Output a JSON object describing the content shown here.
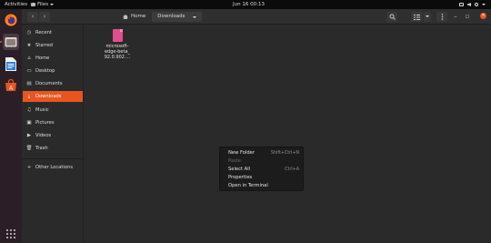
{
  "topbar": {
    "activities": "Activities",
    "app_menu": "Files",
    "clock": "Jun 16  00:13"
  },
  "dock": {
    "apps": [
      "firefox-icon",
      "files-icon",
      "libreoffice-writer-icon",
      "software-center-icon"
    ]
  },
  "window": {
    "breadcrumbs": [
      {
        "label": "Home"
      },
      {
        "label": "Downloads"
      }
    ]
  },
  "sidebar": {
    "items": [
      {
        "label": "Recent",
        "icon": "clock-icon"
      },
      {
        "label": "Starred",
        "icon": "star-icon"
      },
      {
        "label": "Home",
        "icon": "home-icon"
      },
      {
        "label": "Desktop",
        "icon": "desktop-icon"
      },
      {
        "label": "Documents",
        "icon": "documents-icon"
      },
      {
        "label": "Downloads",
        "icon": "downloads-icon",
        "selected": true
      },
      {
        "label": "Music",
        "icon": "music-icon"
      },
      {
        "label": "Pictures",
        "icon": "pictures-icon"
      },
      {
        "label": "Videos",
        "icon": "videos-icon"
      },
      {
        "label": "Trash",
        "icon": "trash-icon"
      },
      {
        "label": "Other Locations",
        "icon": "plus-icon"
      }
    ]
  },
  "files": [
    {
      "name_line1": "microsoft-",
      "name_line2": "edge-beta_",
      "name_line3": "92.0.902...."
    }
  ],
  "context_menu": {
    "items": [
      {
        "label": "New Folder",
        "accel": "Shift+Ctrl+N"
      },
      {
        "label": "Paste",
        "accel": "",
        "disabled": true
      },
      {
        "label": "Select All",
        "accel": "Ctrl+A"
      },
      {
        "label": "Properties",
        "accel": ""
      },
      {
        "label": "Open in Terminal",
        "accel": ""
      }
    ]
  },
  "colors": {
    "accent": "#e95420",
    "dock_bg": "#2b1f27",
    "window_bg": "#2a2a2a"
  }
}
